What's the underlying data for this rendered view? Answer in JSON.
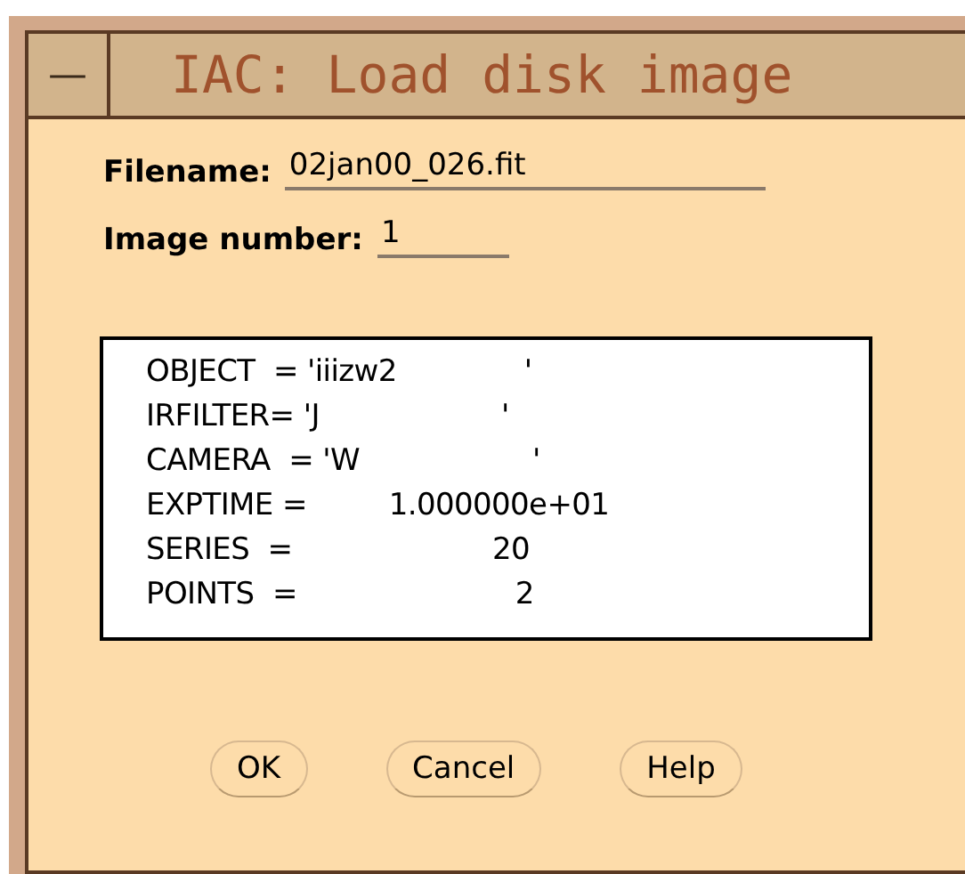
{
  "window": {
    "title": "IAC: Load disk image",
    "menu_button": "—"
  },
  "fields": [
    {
      "label": "Filename:",
      "value": "02jan00_026.fit",
      "kind": "long"
    },
    {
      "label": "Image number:",
      "value": "1",
      "kind": "short"
    }
  ],
  "header_lines": [
    "OBJECT  = 'iiizw2              '",
    "IRFILTER= 'J                    '",
    "CAMERA  = 'W                   '",
    "EXPTIME =         1.000000e+01",
    "SERIES  =                      20",
    "POINTS  =                        2"
  ],
  "buttons": [
    "OK",
    "Cancel",
    "Help"
  ]
}
